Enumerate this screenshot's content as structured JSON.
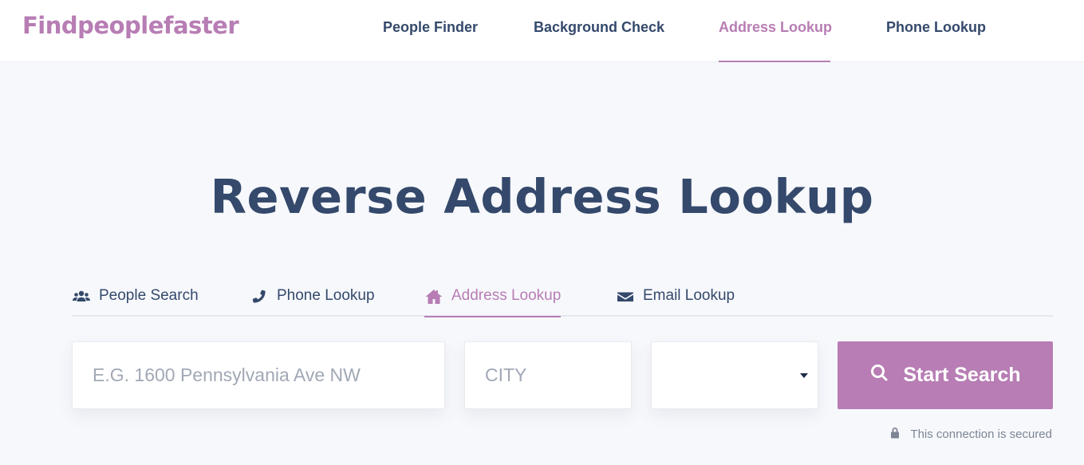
{
  "header": {
    "logo": "Findpeoplefaster",
    "nav": [
      {
        "label": "People Finder",
        "active": false
      },
      {
        "label": "Background Check",
        "active": false
      },
      {
        "label": "Address Lookup",
        "active": true
      },
      {
        "label": "Phone Lookup",
        "active": false
      }
    ]
  },
  "main": {
    "title": "Reverse Address Lookup",
    "tabs": [
      {
        "label": "People Search",
        "icon": "users-icon",
        "active": false
      },
      {
        "label": "Phone Lookup",
        "icon": "phone-icon",
        "active": false
      },
      {
        "label": "Address Lookup",
        "icon": "home-icon",
        "active": true
      },
      {
        "label": "Email Lookup",
        "icon": "envelope-icon",
        "active": false
      }
    ],
    "form": {
      "address_placeholder": "E.G. 1600 Pennsylvania Ave NW",
      "address_value": "",
      "city_placeholder": "CITY",
      "city_value": "",
      "state_value": "",
      "submit_label": "Start Search"
    },
    "secure_note": "This connection is secured"
  },
  "colors": {
    "accent": "#b77db4",
    "text": "#34496b",
    "background": "#f7f8fc"
  }
}
